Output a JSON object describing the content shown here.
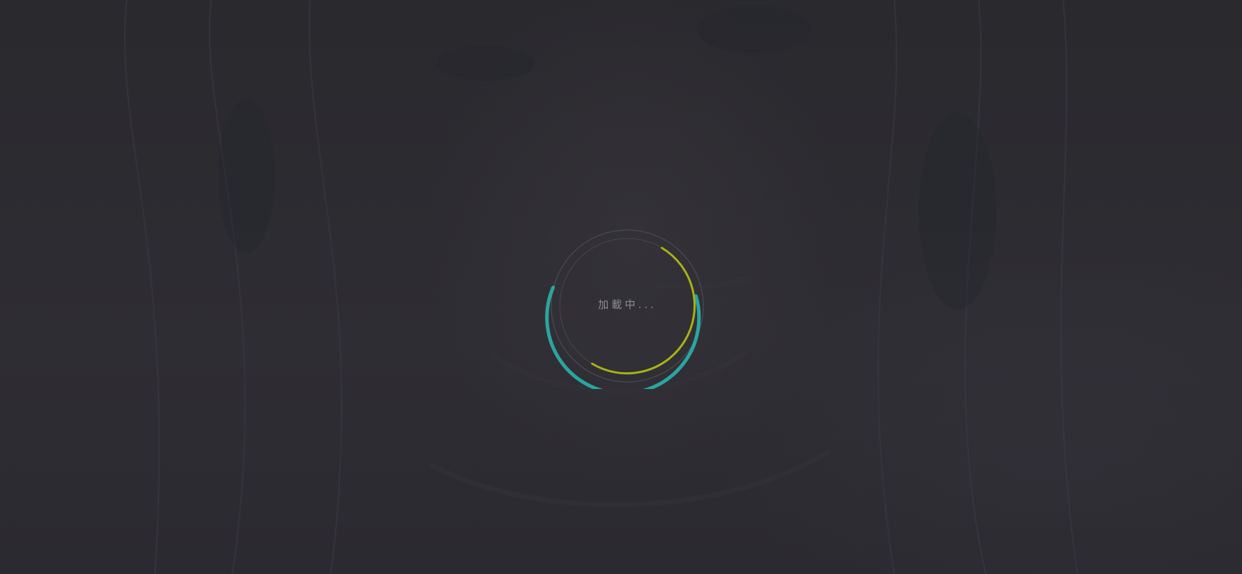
{
  "loader": {
    "text": "加載中...",
    "colors": {
      "outer_track": "#4a4950",
      "inner_track": "#45444b",
      "outer_arc": "#2aa5a0",
      "inner_arc": "#a9b313",
      "text": "#8d8c92",
      "background": "#2b2a2f"
    }
  },
  "background": {
    "image": "dark-illustration-portrait"
  }
}
